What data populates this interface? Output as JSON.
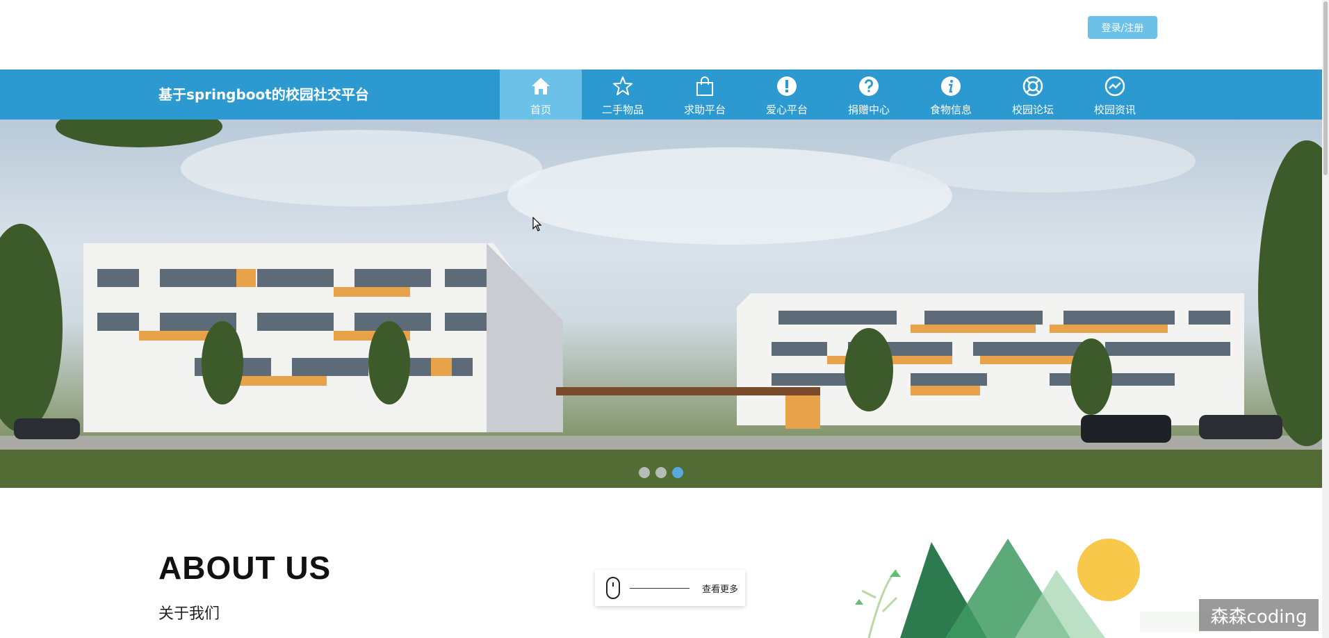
{
  "header": {
    "login_label": "登录/注册"
  },
  "nav": {
    "title": "基于springboot的校园社交平台",
    "items": [
      {
        "label": "首页",
        "icon": "home-icon",
        "active": true
      },
      {
        "label": "二手物品",
        "icon": "star-icon"
      },
      {
        "label": "求助平台",
        "icon": "shopping-bag-icon"
      },
      {
        "label": "爱心平台",
        "icon": "exclamation-icon"
      },
      {
        "label": "捐赠中心",
        "icon": "question-icon"
      },
      {
        "label": "食物信息",
        "icon": "info-icon"
      },
      {
        "label": "校园论坛",
        "icon": "lifebuoy-icon"
      },
      {
        "label": "校园资讯",
        "icon": "trend-icon"
      }
    ],
    "colors": {
      "bar": "#2c9ad1",
      "active": "#6cc1e9"
    }
  },
  "banner": {
    "slide_count": 3,
    "active_slide": 3
  },
  "about": {
    "title": "ABOUT US",
    "subtitle": "关于我们",
    "more_label": "查看更多"
  },
  "watermark": "森森coding"
}
